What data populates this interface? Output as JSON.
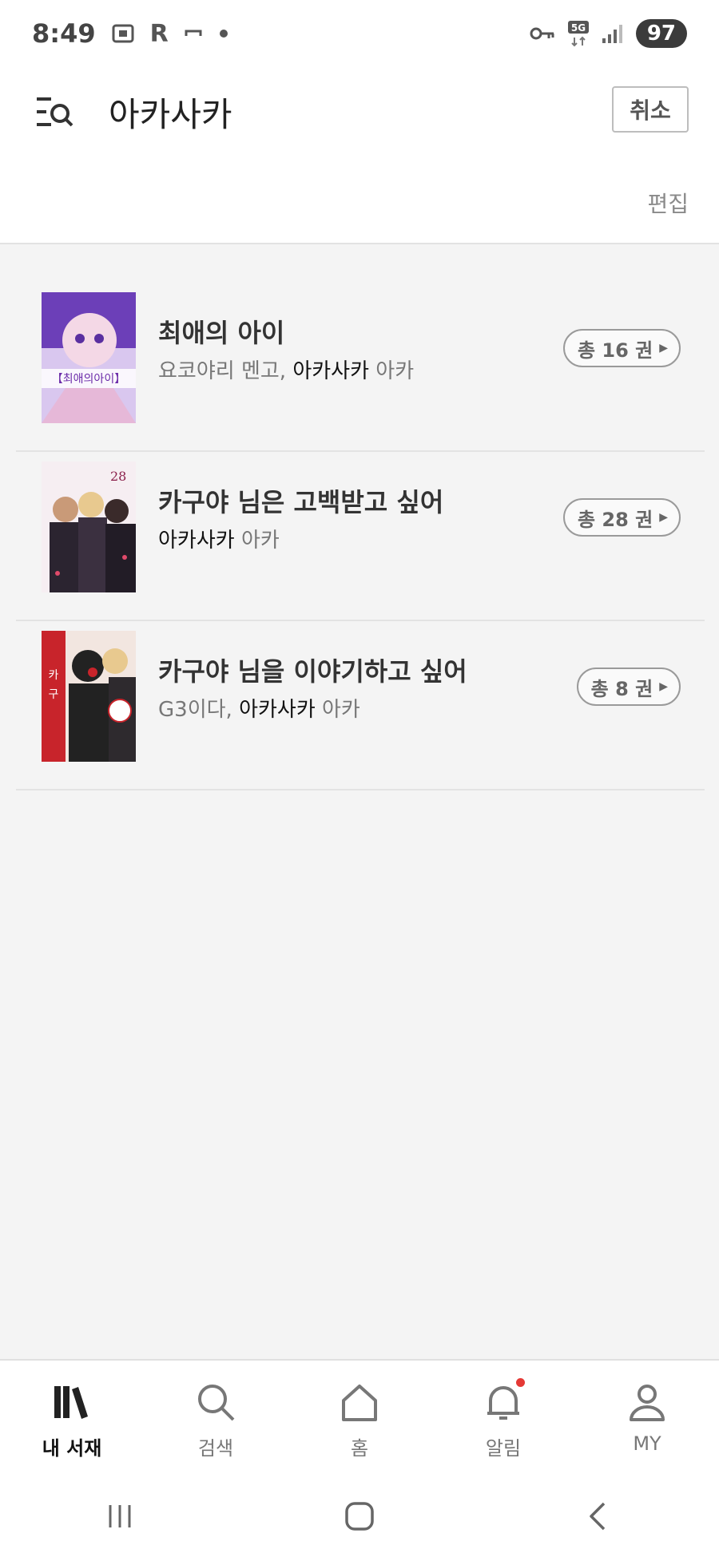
{
  "status_bar": {
    "time": "8:49",
    "indicators": [
      "screenshot-icon",
      "R",
      "minus-icon",
      "dot-icon"
    ],
    "battery": "97",
    "network": "5G"
  },
  "header": {
    "title": "아카사카",
    "cancel_label": "취소",
    "edit_label": "편집"
  },
  "books": [
    {
      "title": "최애의 아이",
      "authors_plain": "요코야리 멘고, ",
      "author_highlight": "아카사카",
      "author_suffix": " 아카",
      "count_label": "총 16 권",
      "cover_palette": [
        "#c9b8e8",
        "#7b4fc4",
        "#f3d3ea"
      ]
    },
    {
      "title": "카구야 님은 고백받고 싶어",
      "authors_plain": "",
      "author_highlight": "아카사카",
      "author_suffix": " 아카",
      "count_label": "총 28 권",
      "cover_palette": [
        "#f5e9ee",
        "#2b2430",
        "#d7b49a"
      ]
    },
    {
      "title": "카구야 님을 이야기하고 싶어",
      "authors_plain": "G3이다, ",
      "author_highlight": "아카사카",
      "author_suffix": " 아카",
      "count_label": "총 8 권",
      "cover_palette": [
        "#c8242b",
        "#222222",
        "#f2e6e0"
      ]
    }
  ],
  "bottom_nav": [
    {
      "label": "내 서재",
      "icon": "library-icon",
      "active": true
    },
    {
      "label": "검색",
      "icon": "search-icon",
      "active": false
    },
    {
      "label": "홈",
      "icon": "home-icon",
      "active": false
    },
    {
      "label": "알림",
      "icon": "bell-icon",
      "active": false,
      "has_badge": true
    },
    {
      "label": "MY",
      "icon": "person-icon",
      "active": false
    }
  ],
  "colors": {
    "background": "#f4f4f4",
    "surface": "#ffffff",
    "badge": "#e53935"
  }
}
